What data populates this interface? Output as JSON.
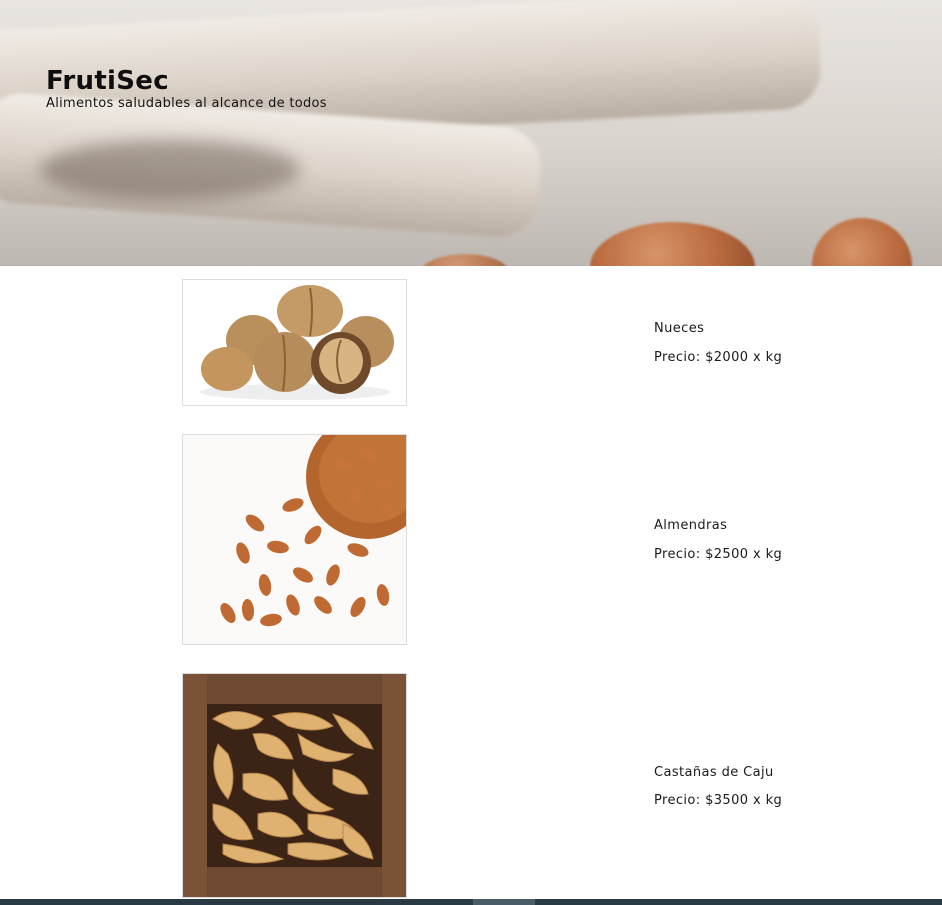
{
  "header": {
    "title": "FrutiSec",
    "subtitle": "Alimentos saludables al alcance de todos"
  },
  "products": [
    {
      "name": "Nueces",
      "price": "Precio: $2000 x kg",
      "image": "walnuts-image"
    },
    {
      "name": "Almendras",
      "price": "Precio: $2500 x kg",
      "image": "almonds-image"
    },
    {
      "name": "Castañas de Caju",
      "price": "Precio: $3500 x kg",
      "image": "cashews-image"
    }
  ],
  "colors": {
    "footer": "#2a3a45",
    "text": "#1a1a1a"
  }
}
